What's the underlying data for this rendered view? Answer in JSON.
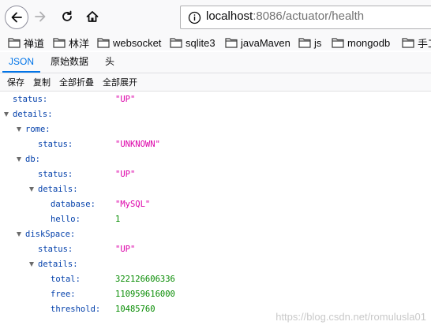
{
  "browser": {
    "url_host": "localhost",
    "url_rest": ":8086/actuator/health"
  },
  "bookmarks": [
    "禅道",
    "林洋",
    "websocket",
    "sqlite3",
    "javaMaven",
    "js",
    "mongodb",
    "手工"
  ],
  "tabs": {
    "json": "JSON",
    "raw": "原始数据",
    "headers": "头"
  },
  "actions": {
    "save": "保存",
    "copy": "复制",
    "collapse_all": "全部折叠",
    "expand_all": "全部展开"
  },
  "tree": [
    {
      "key": "status:",
      "value": "\"UP\"",
      "type": "str",
      "depth": 0,
      "expandable": false
    },
    {
      "key": "details:",
      "value": "",
      "type": "",
      "depth": 0,
      "expandable": true
    },
    {
      "key": "rome:",
      "value": "",
      "type": "",
      "depth": 1,
      "expandable": true
    },
    {
      "key": "status:",
      "value": "\"UNKNOWN\"",
      "type": "str",
      "depth": 2,
      "expandable": false
    },
    {
      "key": "db:",
      "value": "",
      "type": "",
      "depth": 1,
      "expandable": true
    },
    {
      "key": "status:",
      "value": "\"UP\"",
      "type": "str",
      "depth": 2,
      "expandable": false
    },
    {
      "key": "details:",
      "value": "",
      "type": "",
      "depth": 2,
      "expandable": true
    },
    {
      "key": "database:",
      "value": "\"MySQL\"",
      "type": "str",
      "depth": 3,
      "expandable": false
    },
    {
      "key": "hello:",
      "value": "1",
      "type": "num",
      "depth": 3,
      "expandable": false
    },
    {
      "key": "diskSpace:",
      "value": "",
      "type": "",
      "depth": 1,
      "expandable": true
    },
    {
      "key": "status:",
      "value": "\"UP\"",
      "type": "str",
      "depth": 2,
      "expandable": false
    },
    {
      "key": "details:",
      "value": "",
      "type": "",
      "depth": 2,
      "expandable": true
    },
    {
      "key": "total:",
      "value": "322126606336",
      "type": "num",
      "depth": 3,
      "expandable": false
    },
    {
      "key": "free:",
      "value": "110959616000",
      "type": "num",
      "depth": 3,
      "expandable": false
    },
    {
      "key": "threshold:",
      "value": "10485760",
      "type": "num",
      "depth": 3,
      "expandable": false
    }
  ],
  "watermark": "https://blog.csdn.net/romulusla01",
  "colors": {
    "key": "#003eaa",
    "string": "#dd00a9",
    "number": "#058b00",
    "active_tab": "#0074e8"
  },
  "icons": {
    "back": "arrow-left-icon",
    "forward": "arrow-right-icon",
    "reload": "reload-icon",
    "home": "home-icon",
    "info": "info-circle-icon",
    "bookmark": "folder-icon"
  }
}
